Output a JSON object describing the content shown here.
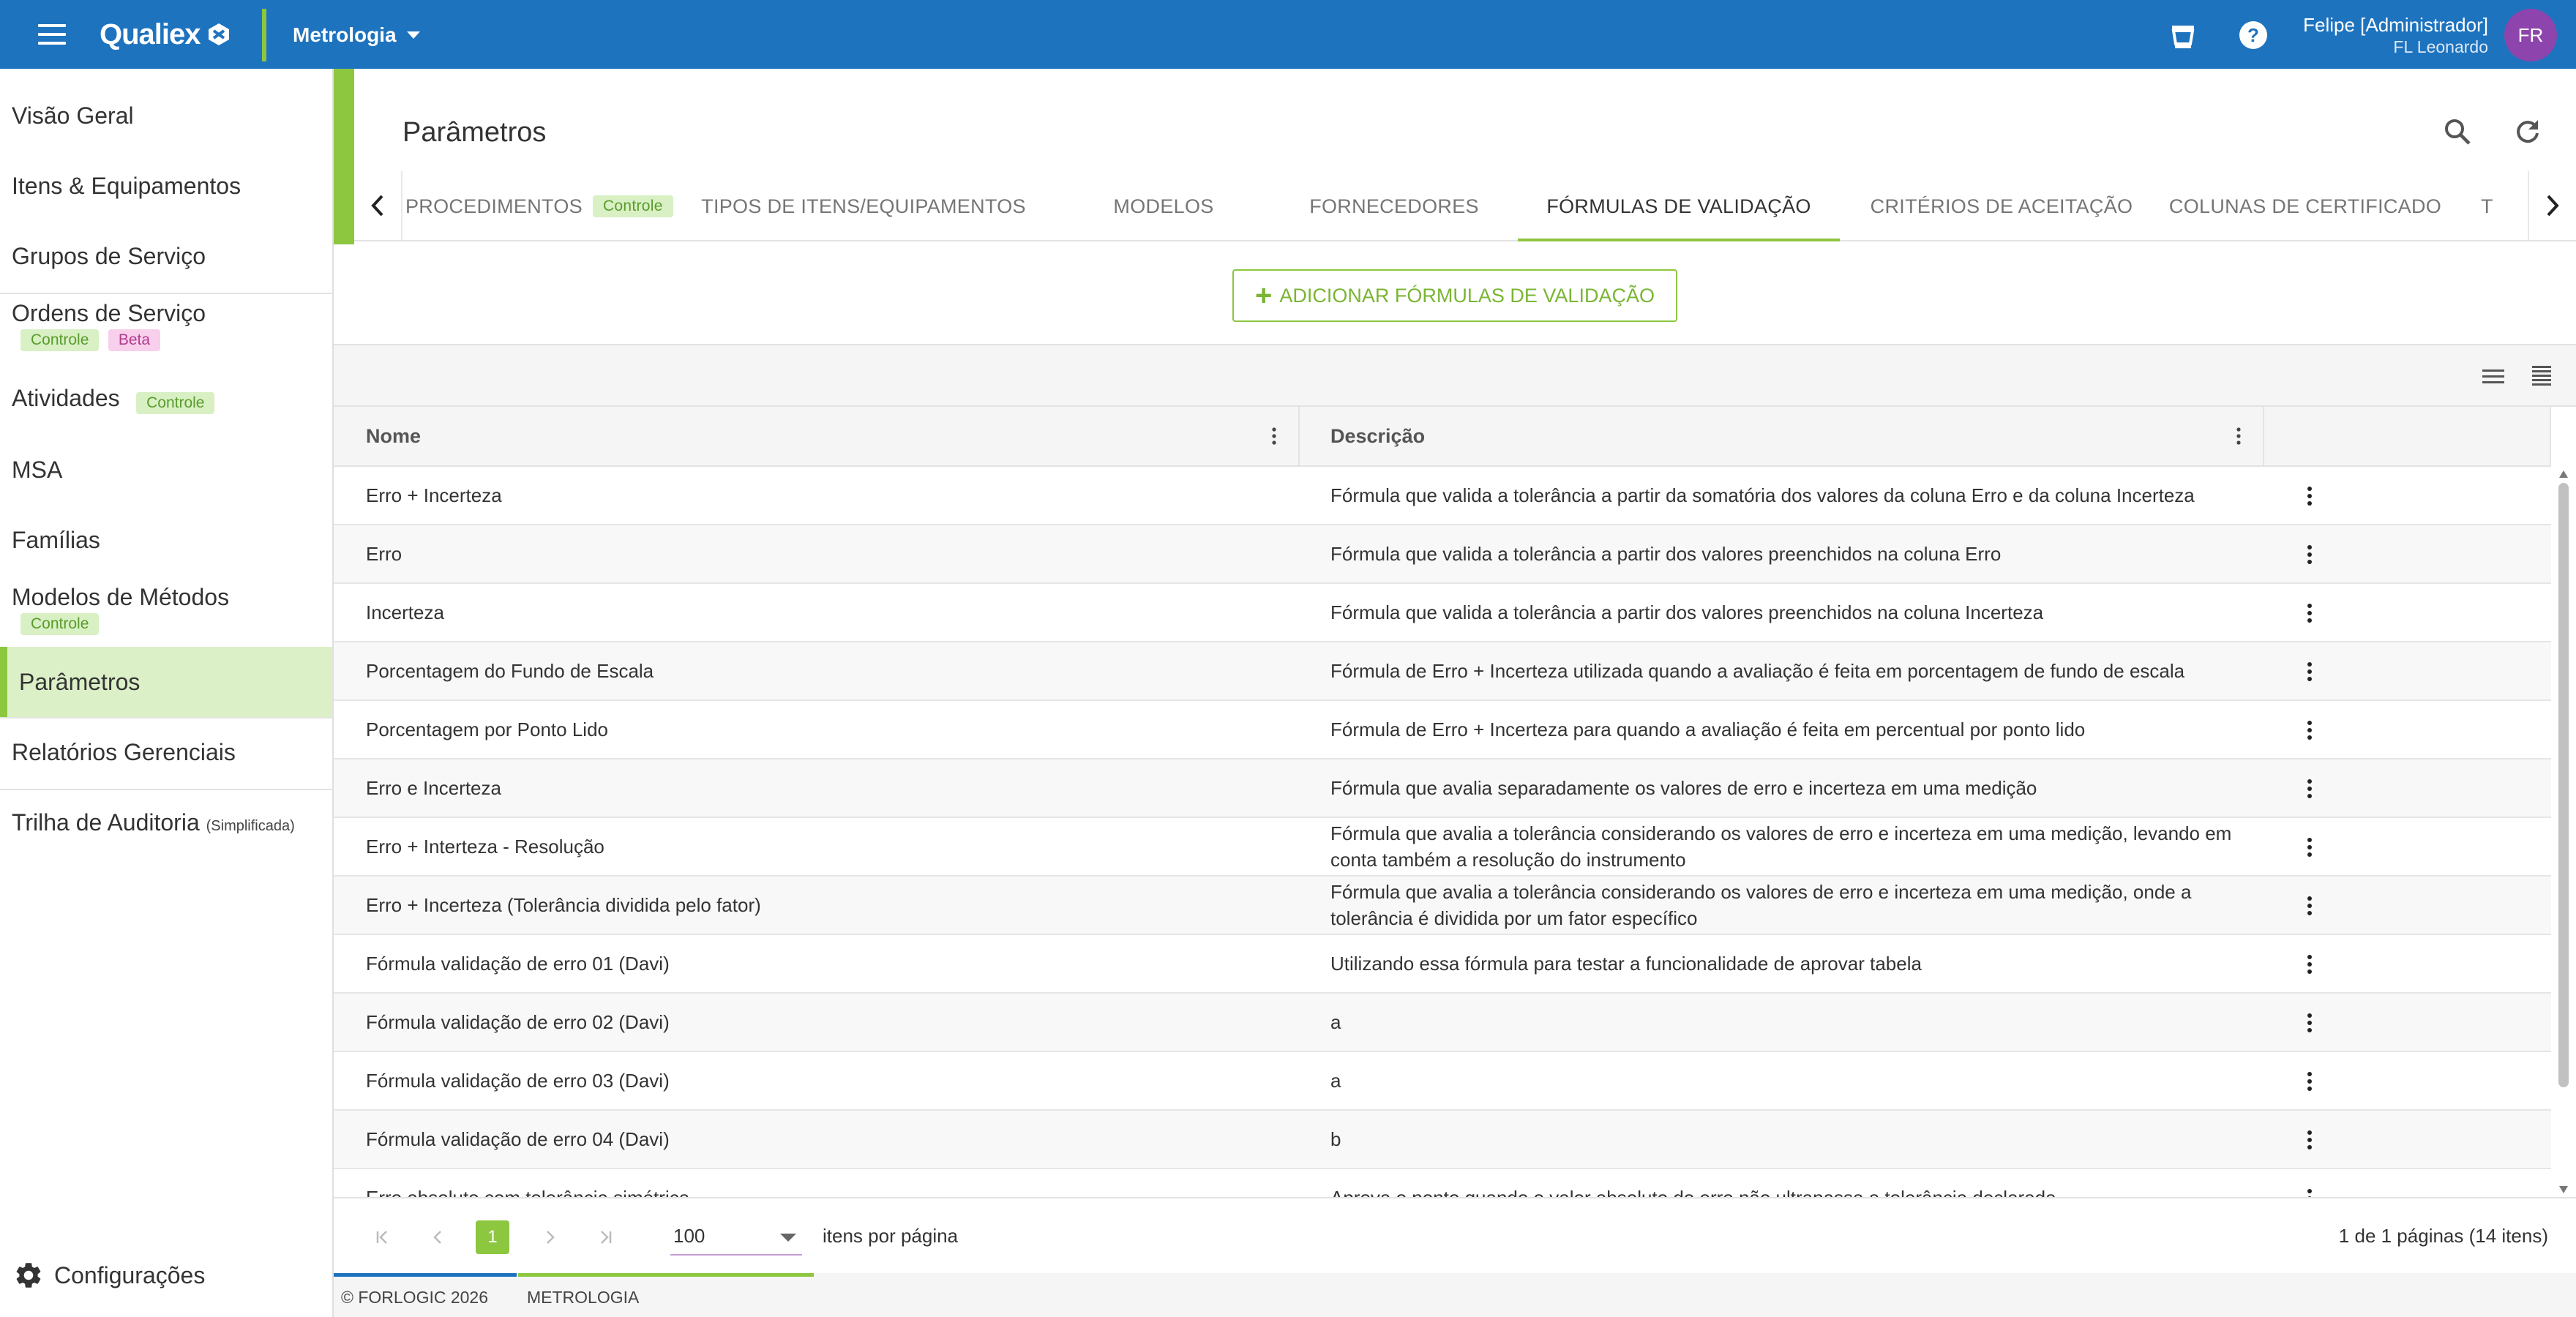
{
  "topbar": {
    "logo_text": "Qualiex",
    "module": "Metrologia",
    "user_name": "Felipe [Administrador]",
    "user_company": "FL Leonardo",
    "avatar_initials": "FR",
    "colors": {
      "bar": "#1e73be",
      "accent": "#8dc63f",
      "avatar": "#8e44ad"
    }
  },
  "sidebar": {
    "items": [
      {
        "label": "Visão Geral"
      },
      {
        "label": "Itens & Equipamentos"
      },
      {
        "label": "Grupos de Serviço"
      },
      {
        "label": "Ordens de Serviço",
        "badges": [
          "Controle",
          "Beta"
        ]
      },
      {
        "label": "Atividades",
        "badges": [
          "Controle"
        ]
      },
      {
        "label": "MSA"
      },
      {
        "label": "Famílias"
      },
      {
        "label": "Modelos de Métodos",
        "badges": [
          "Controle"
        ]
      },
      {
        "label": "Parâmetros",
        "active": true
      },
      {
        "label": "Relatórios Gerenciais"
      },
      {
        "label": "Trilha de Auditoria",
        "suffix": "(Simplificada)"
      }
    ],
    "config_label": "Configurações"
  },
  "page": {
    "title": "Parâmetros",
    "tabs": [
      {
        "label": "PROCEDIMENTOS",
        "badge": "Controle"
      },
      {
        "label": "TIPOS DE ITENS/EQUIPAMENTOS"
      },
      {
        "label": "MODELOS"
      },
      {
        "label": "FORNECEDORES"
      },
      {
        "label": "FÓRMULAS DE VALIDAÇÃO",
        "active": true
      },
      {
        "label": "CRITÉRIOS DE ACEITAÇÃO"
      },
      {
        "label": "COLUNAS DE CERTIFICADO"
      },
      {
        "label": "T"
      }
    ],
    "add_button_label": "ADICIONAR FÓRMULAS DE VALIDAÇÃO"
  },
  "table": {
    "columns": [
      "Nome",
      "Descrição"
    ],
    "rows": [
      {
        "name": "Erro + Incerteza",
        "description": "Fórmula que valida a tolerância a partir da somatória dos valores da coluna Erro e da coluna Incerteza"
      },
      {
        "name": "Erro",
        "description": "Fórmula que valida a tolerância a partir dos valores preenchidos na coluna Erro"
      },
      {
        "name": "Incerteza",
        "description": "Fórmula que valida a tolerância a partir dos valores preenchidos na coluna Incerteza"
      },
      {
        "name": "Porcentagem do Fundo de Escala",
        "description": "Fórmula de Erro + Incerteza utilizada quando a avaliação é feita em porcentagem de fundo de escala"
      },
      {
        "name": "Porcentagem por Ponto Lido",
        "description": "Fórmula de Erro + Incerteza para quando a avaliação é feita em percentual por ponto lido"
      },
      {
        "name": "Erro e Incerteza",
        "description": "Fórmula que avalia separadamente os valores de erro e incerteza em uma medição"
      },
      {
        "name": "Erro + Interteza - Resolução",
        "description": "Fórmula que avalia a tolerância considerando os valores de erro e incerteza em uma medição, levando em conta também a resolução do instrumento"
      },
      {
        "name": "Erro + Incerteza (Tolerância dividida pelo fator)",
        "description": "Fórmula que avalia a tolerância considerando os valores de erro e incerteza em uma medição, onde a tolerância é dividida por um fator específico"
      },
      {
        "name": "Fórmula validação de erro 01 (Davi)",
        "description": "Utilizando essa fórmula para testar a funcionalidade de aprovar tabela"
      },
      {
        "name": "Fórmula validação de erro 02 (Davi)",
        "description": "a"
      },
      {
        "name": "Fórmula validação de erro 03 (Davi)",
        "description": "a"
      },
      {
        "name": "Fórmula validação de erro 04 (Davi)",
        "description": "b"
      },
      {
        "name": "Erro absoluto com tolerância simétrica",
        "description": "Aprova o ponto quando o valor absoluto do erro não ultrapassa a tolerância declarada"
      }
    ]
  },
  "pagination": {
    "current_page": "1",
    "page_size": "100",
    "per_page_label": "itens por página",
    "summary": "1 de 1 páginas (14 itens)"
  },
  "footer": {
    "copyright": "© FORLOGIC 2026",
    "module": "METROLOGIA"
  }
}
